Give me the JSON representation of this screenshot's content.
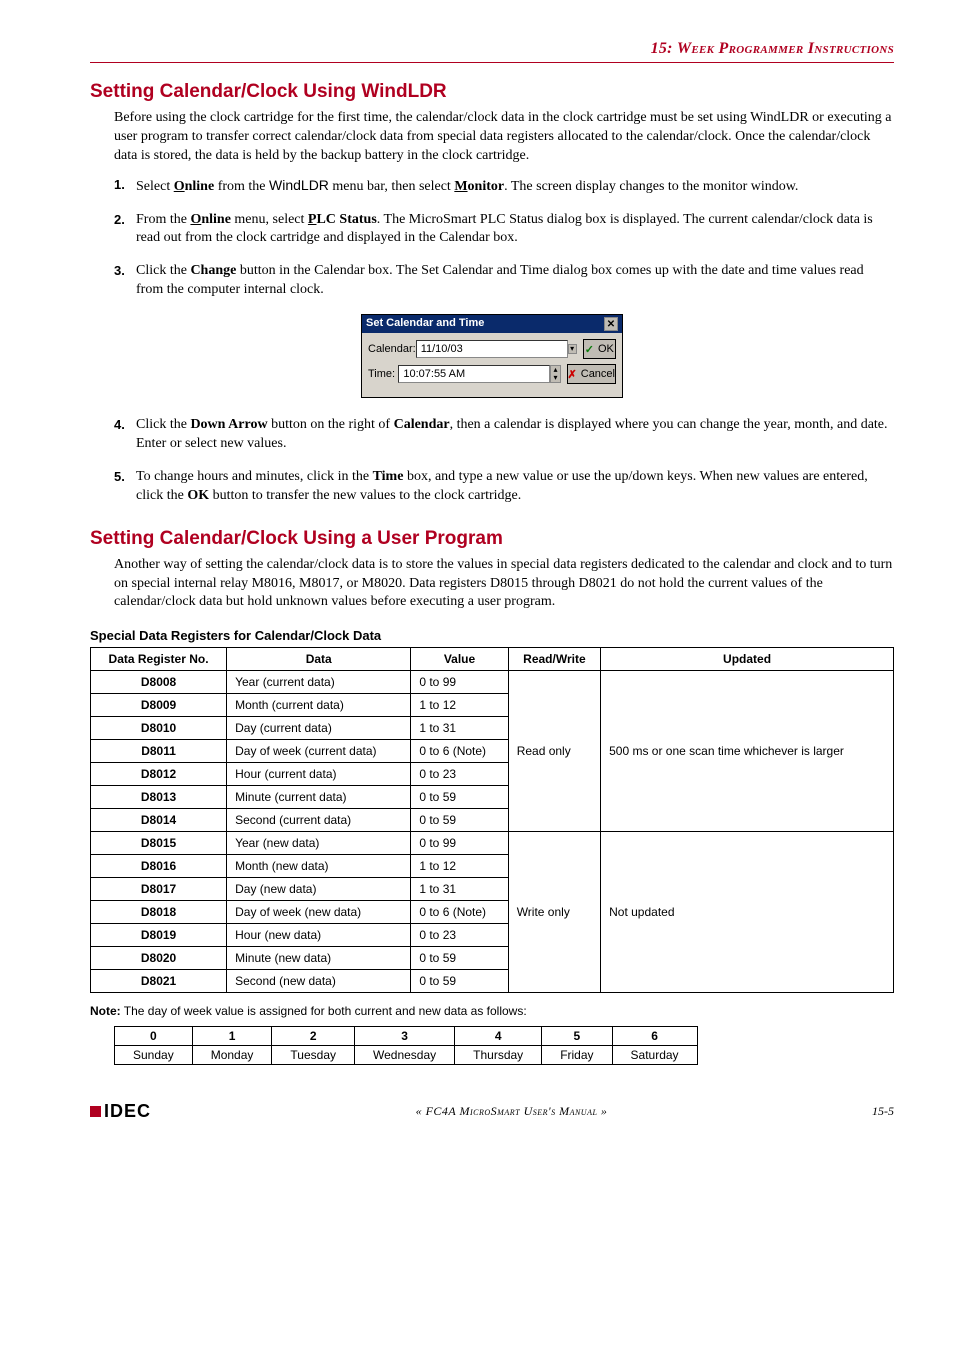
{
  "chapter_header": "15: Week Programmer Instructions",
  "section1": {
    "title": "Setting Calendar/Clock Using WindLDR",
    "intro": "Before using the clock cartridge for the first time, the calendar/clock data in the clock cartridge must be set using WindLDR or executing a user program to transfer correct calendar/clock data from special data registers allocated to the calendar/clock. Once the calendar/clock data is stored, the data is held by the backup battery in the clock cartridge.",
    "steps": {
      "s1_pre": "Select ",
      "s1_bold1": "Online",
      "s1_mid1": " from the ",
      "s1_sans": "WindLDR",
      "s1_mid2": " menu bar, then select ",
      "s1_bold2": "Monitor",
      "s1_post": ". The screen display changes to the monitor window.",
      "s2_pre": "From the ",
      "s2_bold1": "Online",
      "s2_mid1": " menu, select ",
      "s2_bold2": "PLC Status",
      "s2_post": ". The MicroSmart PLC Status dialog box is displayed. The current calendar/clock data is read out from the clock cartridge and displayed in the Calendar box.",
      "s3_pre": "Click the ",
      "s3_bold1": "Change",
      "s3_post": " button in the Calendar box. The Set Calendar and Time dialog box comes up with the date and time values read from the computer internal clock.",
      "s4_pre": "Click the ",
      "s4_bold1": "Down Arrow",
      "s4_mid1": " button on the right of ",
      "s4_bold2": "Calendar",
      "s4_post": ", then a calendar is displayed where you can change the year, month, and date. Enter or select new values.",
      "s5_pre": "To change hours and minutes, click in the ",
      "s5_bold1": "Time",
      "s5_mid1": " box, and type a new value or use the up/down keys. When new values are entered, click the ",
      "s5_bold2": "OK",
      "s5_post": " button to transfer the new values to the clock cartridge."
    }
  },
  "dialog": {
    "title": "Set Calendar and Time",
    "calendar_label": "Calendar:",
    "calendar_value": "11/10/03",
    "time_label": "Time:",
    "time_value": "10:07:55 AM",
    "ok": "OK",
    "cancel": "Cancel"
  },
  "section2": {
    "title": "Setting Calendar/Clock Using a User Program",
    "intro": "Another way of setting the calendar/clock data is to store the values in special data registers dedicated to the calendar and clock and to turn on special internal relay M8016, M8017, or M8020. Data registers D8015 through D8021 do not hold the current values of the calendar/clock data but hold unknown values before executing a user program."
  },
  "table": {
    "heading": "Special Data Registers for Calendar/Clock Data",
    "headers": [
      "Data Register No.",
      "Data",
      "Value",
      "Read/Write",
      "Updated"
    ],
    "rows": [
      {
        "reg": "D8008",
        "data": "Year (current data)",
        "value": "0 to 99"
      },
      {
        "reg": "D8009",
        "data": "Month (current data)",
        "value": "1 to 12"
      },
      {
        "reg": "D8010",
        "data": "Day (current data)",
        "value": "1 to 31"
      },
      {
        "reg": "D8011",
        "data": "Day of week (current data)",
        "value": "0 to 6 (Note)"
      },
      {
        "reg": "D8012",
        "data": "Hour (current data)",
        "value": "0 to 23"
      },
      {
        "reg": "D8013",
        "data": "Minute (current data)",
        "value": "0 to 59"
      },
      {
        "reg": "D8014",
        "data": "Second (current data)",
        "value": "0 to 59"
      },
      {
        "reg": "D8015",
        "data": "Year (new data)",
        "value": "0 to 99"
      },
      {
        "reg": "D8016",
        "data": "Month (new data)",
        "value": "1 to 12"
      },
      {
        "reg": "D8017",
        "data": "Day (new data)",
        "value": "1 to 31"
      },
      {
        "reg": "D8018",
        "data": "Day of week (new data)",
        "value": "0 to 6 (Note)"
      },
      {
        "reg": "D8019",
        "data": "Hour (new data)",
        "value": "0 to 23"
      },
      {
        "reg": "D8020",
        "data": "Minute (new data)",
        "value": "0 to 59"
      },
      {
        "reg": "D8021",
        "data": "Second (new data)",
        "value": "0 to 59"
      }
    ],
    "read_only": "Read only",
    "write_only": "Write only",
    "updated_ro": "500 ms or one scan time whichever is larger",
    "updated_wo": "Not updated"
  },
  "note_label": "Note:",
  "note_text": " The day of week value is assigned for both current and new data as follows:",
  "dow": {
    "nums": [
      "0",
      "1",
      "2",
      "3",
      "4",
      "5",
      "6"
    ],
    "days": [
      "Sunday",
      "Monday",
      "Tuesday",
      "Wednesday",
      "Thursday",
      "Friday",
      "Saturday"
    ]
  },
  "footer": {
    "logo": "IDEC",
    "manual": "« FC4A MicroSmart User's Manual »",
    "page": "15-5"
  }
}
